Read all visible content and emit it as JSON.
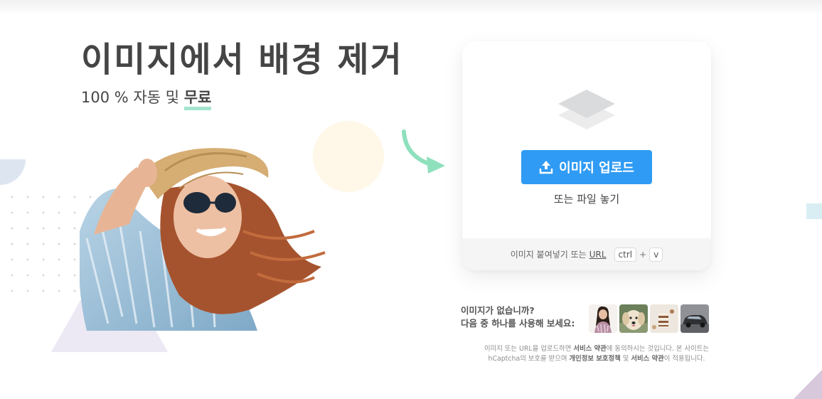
{
  "hero": {
    "title": "이미지에서 배경 제거",
    "subtitle_prefix": "100 % 자동 및 ",
    "subtitle_highlight": "무료"
  },
  "upload": {
    "button_label": "이미지 업로드",
    "drop_text": "또는 파일 놓기",
    "paste_text": "이미지 붙여넣기 또는",
    "url_link": "URL",
    "shortcut_key1": "ctrl",
    "shortcut_plus": "+",
    "shortcut_key2": "v"
  },
  "samples": {
    "line1": "이미지가 없습니까?",
    "line2": "다음 중 하나를 사용해 보세요:",
    "items": [
      "woman-portrait",
      "dog",
      "cake",
      "car"
    ]
  },
  "terms": {
    "t1": "이미지 또는 URL을 업로드하면 ",
    "link1": "서비스 약관",
    "t2": "에 동의하시는 것입니다. 본 사이트는",
    "t3": "hCaptcha의 보호를 받으며 ",
    "link2": "개인정보 보호정책",
    "t4": " 및 ",
    "link3": "서비스 약관",
    "t5": "이 적용됩니다."
  },
  "colors": {
    "accent": "#2f9bf4",
    "highlight_underline": "#a3e4cf",
    "arrow": "#8fe0bd",
    "text": "#454545"
  },
  "icons": [
    "layers-icon",
    "upload-icon",
    "curved-arrow-icon"
  ]
}
